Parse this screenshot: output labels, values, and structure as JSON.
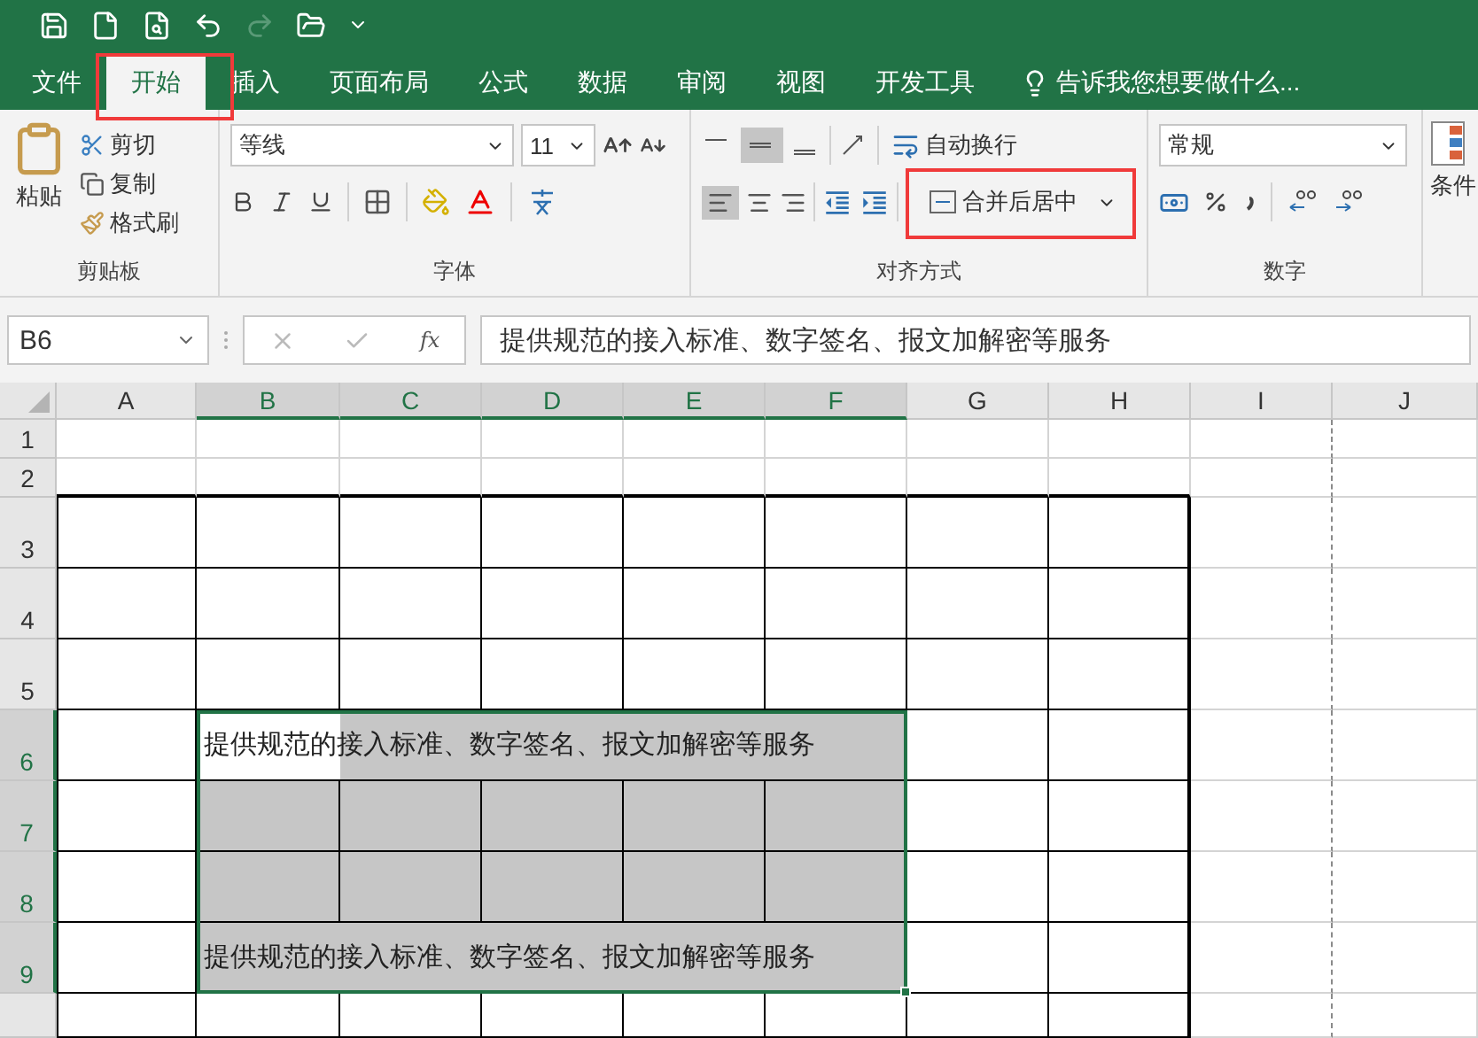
{
  "tabs": [
    {
      "label": "文件",
      "selected": false,
      "highlighted": false
    },
    {
      "label": "开始",
      "selected": true,
      "highlighted": true
    },
    {
      "label": "插入",
      "selected": false,
      "highlighted": false
    },
    {
      "label": "页面布局",
      "selected": false,
      "highlighted": false
    },
    {
      "label": "公式",
      "selected": false,
      "highlighted": false
    },
    {
      "label": "数据",
      "selected": false,
      "highlighted": false
    },
    {
      "label": "审阅",
      "selected": false,
      "highlighted": false
    },
    {
      "label": "视图",
      "selected": false,
      "highlighted": false
    },
    {
      "label": "开发工具",
      "selected": false,
      "highlighted": false
    }
  ],
  "tell_me": "告诉我您想要做什么...",
  "ribbon": {
    "clipboard": {
      "label": "剪贴板",
      "paste": "粘贴",
      "cut": "剪切",
      "copy": "复制",
      "format_painter": "格式刷"
    },
    "font": {
      "label": "字体",
      "font_name": "等线",
      "font_size": "11"
    },
    "alignment": {
      "label": "对齐方式",
      "wrap_text": "自动换行",
      "merge": {
        "label": "合并后居中",
        "highlighted": true
      }
    },
    "number": {
      "label": "数字",
      "format": "常规"
    },
    "styles": {
      "conditional": "条件"
    }
  },
  "formula_bar": {
    "name_box": "B6",
    "fx": "fx",
    "formula": "提供规范的接入标准、数字签名、报文加解密等服务"
  },
  "sheet": {
    "columns": [
      {
        "label": "A",
        "selected": false
      },
      {
        "label": "B",
        "selected": true
      },
      {
        "label": "C",
        "selected": true
      },
      {
        "label": "D",
        "selected": true
      },
      {
        "label": "E",
        "selected": true
      },
      {
        "label": "F",
        "selected": true
      },
      {
        "label": "G",
        "selected": false
      },
      {
        "label": "H",
        "selected": false
      },
      {
        "label": "I",
        "selected": false
      },
      {
        "label": "J",
        "selected": false
      }
    ],
    "rows": [
      {
        "label": "1",
        "selected": false,
        "bordered": false
      },
      {
        "label": "2",
        "selected": false,
        "bordered": false
      },
      {
        "label": "3",
        "selected": false,
        "bordered": true
      },
      {
        "label": "4",
        "selected": false,
        "bordered": true
      },
      {
        "label": "5",
        "selected": false,
        "bordered": true
      },
      {
        "label": "6",
        "selected": true,
        "bordered": true,
        "merged_text": "提供规范的接入标准、数字签名、报文加解密等服务"
      },
      {
        "label": "7",
        "selected": true,
        "bordered": true,
        "filled": true
      },
      {
        "label": "8",
        "selected": true,
        "bordered": true,
        "filled": true
      },
      {
        "label": "9",
        "selected": true,
        "bordered": true,
        "merged_text": "提供规范的接入标准、数字签名、报文加解密等服务"
      },
      {
        "selected": false,
        "bordered": true
      }
    ]
  }
}
